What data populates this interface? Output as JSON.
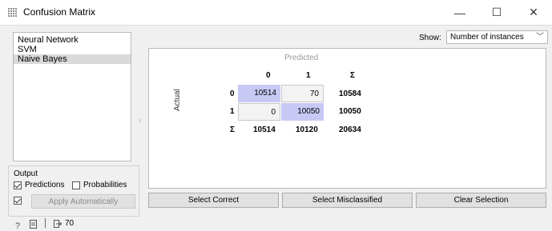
{
  "window": {
    "title": "Confusion Matrix",
    "min_glyph": "—",
    "max_glyph": "☐",
    "close_glyph": "✕"
  },
  "learners": [
    "Neural Network",
    "SVM",
    "Naive Bayes"
  ],
  "selected_learner": "Naive Bayes",
  "output": {
    "title": "Output",
    "predictions_label": "Predictions",
    "predictions_checked": true,
    "probabilities_label": "Probabilities",
    "probabilities_checked": false,
    "auto_checked": true,
    "apply_label": "Apply Automatically"
  },
  "show": {
    "label": "Show:",
    "value": "Number of instances"
  },
  "matrix": {
    "predicted_label": "Predicted",
    "actual_label": "Actual",
    "sum_symbol": "Σ",
    "col_headers": [
      "0",
      "1"
    ],
    "row_headers": [
      "0",
      "1"
    ],
    "cells": [
      [
        "10514",
        "70"
      ],
      [
        "0",
        "10050"
      ]
    ],
    "row_sums": [
      "10584",
      "10050"
    ],
    "col_sums": [
      "10514",
      "10120"
    ],
    "total": "20634"
  },
  "buttons": {
    "select_correct": "Select Correct",
    "select_misclassified": "Select Misclassified",
    "clear_selection": "Clear Selection"
  },
  "status": {
    "output_count": "70"
  },
  "colors": {
    "diag_cell": "#c8c8f5",
    "off_cell": "#f3f3f3"
  }
}
